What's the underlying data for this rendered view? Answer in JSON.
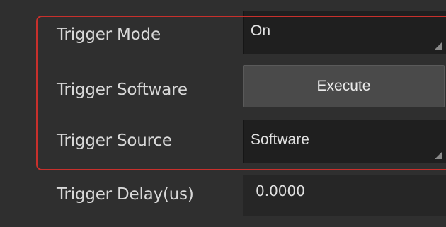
{
  "properties": [
    {
      "label": "Trigger Mode",
      "value": "On",
      "kind": "select"
    },
    {
      "label": "Trigger Software",
      "button_label": "Execute",
      "kind": "button"
    },
    {
      "label": "Trigger Source",
      "value": "Software",
      "kind": "select"
    },
    {
      "label": "Trigger Delay(us)",
      "value": "0.0000",
      "kind": "input"
    }
  ],
  "colors": {
    "background": "#2f2f2f",
    "field_bg": "#1f1f1f",
    "button_bg": "#4a4a4a",
    "label_text": "#d8d8d8",
    "highlight": "#c8302c"
  },
  "icons": [
    "resize-corner-icon"
  ]
}
